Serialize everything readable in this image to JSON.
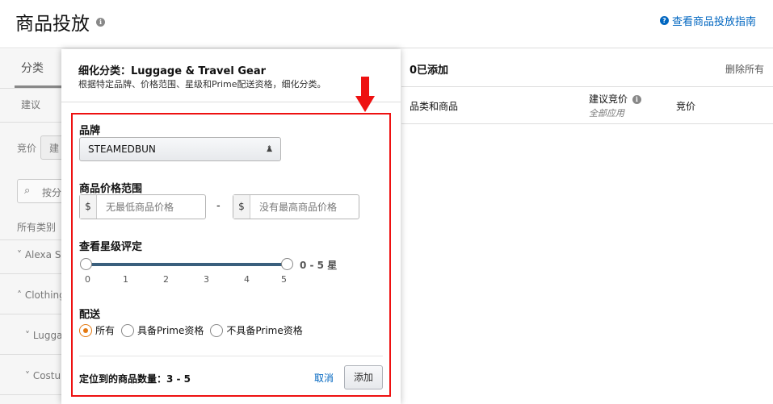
{
  "header": {
    "title": "商品投放",
    "guide_link": "查看商品投放指南"
  },
  "left": {
    "tab_category": "分类",
    "suggest_label": "建议",
    "bid_label": "竞价",
    "bid_box_text": "建",
    "search_placeholder": "按分",
    "all_categories": "所有类别",
    "tree": [
      "Alexa Sk",
      "Clothing",
      "Lugga",
      "Costu"
    ]
  },
  "modal": {
    "title": "细化分类：Luggage & Travel Gear",
    "subtitle": "根据特定品牌、价格范围、星级和Prime配送资格，细化分类。",
    "brand_label": "品牌",
    "brand_value": "STEAMEDBUN",
    "price_label": "商品价格范围",
    "currency": "$",
    "min_placeholder": "无最低商品价格",
    "max_placeholder": "没有最高商品价格",
    "dash": "-",
    "rating_label": "查看星级评定",
    "rating_range": "0 - 5 星",
    "rating_min": 0,
    "rating_max": 5,
    "ticks": [
      "0",
      "1",
      "2",
      "3",
      "4",
      "5"
    ],
    "shipping_label": "配送",
    "shipping_options": [
      "所有",
      "具备Prime资格",
      "不具备Prime资格"
    ],
    "shipping_selected": "所有",
    "count_label": "定位到的商品数量：3 - 5",
    "cancel": "取消",
    "add": "添加"
  },
  "right": {
    "added": "0已添加",
    "delete_all": "删除所有",
    "col_category": "品类和商品",
    "col_suggested": "建议竞价",
    "col_suggested_sub": "全部应用",
    "col_bid": "竞价"
  },
  "colors": {
    "link": "#0066c0",
    "highlight_frame": "#e11111",
    "slider": "#3a5f7d",
    "radio_selected": "#e47911"
  }
}
